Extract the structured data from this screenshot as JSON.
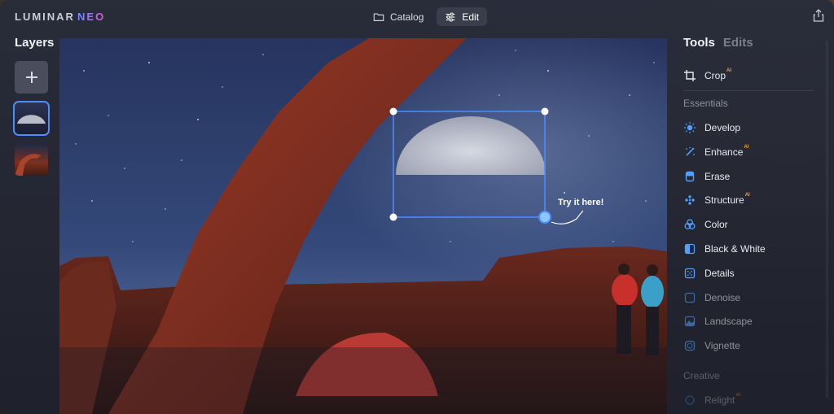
{
  "app": {
    "logo_text": "LUMINAR",
    "logo_accent": "NEO"
  },
  "topnav": {
    "catalog_label": "Catalog",
    "edit_label": "Edit"
  },
  "layers": {
    "title": "Layers"
  },
  "canvas": {
    "hint_text": "Try it here!"
  },
  "right_panel": {
    "tabs": [
      {
        "label": "Tools",
        "active": true
      },
      {
        "label": "Edits",
        "active": false
      }
    ],
    "crop": {
      "label": "Crop",
      "ai": "AI"
    },
    "essentials_title": "Essentials",
    "tools": [
      {
        "label": "Develop",
        "icon": "sun-icon",
        "ai": ""
      },
      {
        "label": "Enhance",
        "icon": "sparkle-wand-icon",
        "ai": "AI"
      },
      {
        "label": "Erase",
        "icon": "eraser-icon",
        "ai": ""
      },
      {
        "label": "Structure",
        "icon": "structure-dots-icon",
        "ai": "AI"
      },
      {
        "label": "Color",
        "icon": "color-circles-icon",
        "ai": ""
      },
      {
        "label": "Black & White",
        "icon": "half-square-icon",
        "ai": ""
      },
      {
        "label": "Details",
        "icon": "grid-icon",
        "ai": ""
      },
      {
        "label": "Denoise",
        "icon": "denoise-square-icon",
        "ai": ""
      },
      {
        "label": "Landscape",
        "icon": "landscape-icon",
        "ai": ""
      },
      {
        "label": "Vignette",
        "icon": "vignette-icon",
        "ai": ""
      }
    ],
    "creative_title": "Creative",
    "creative_tools": [
      {
        "label": "Relight",
        "ai": "AI"
      }
    ]
  },
  "colors": {
    "accent_blue": "#4f8cff",
    "ai_badge": "#f0a040",
    "panel_bg": "#262a36"
  }
}
